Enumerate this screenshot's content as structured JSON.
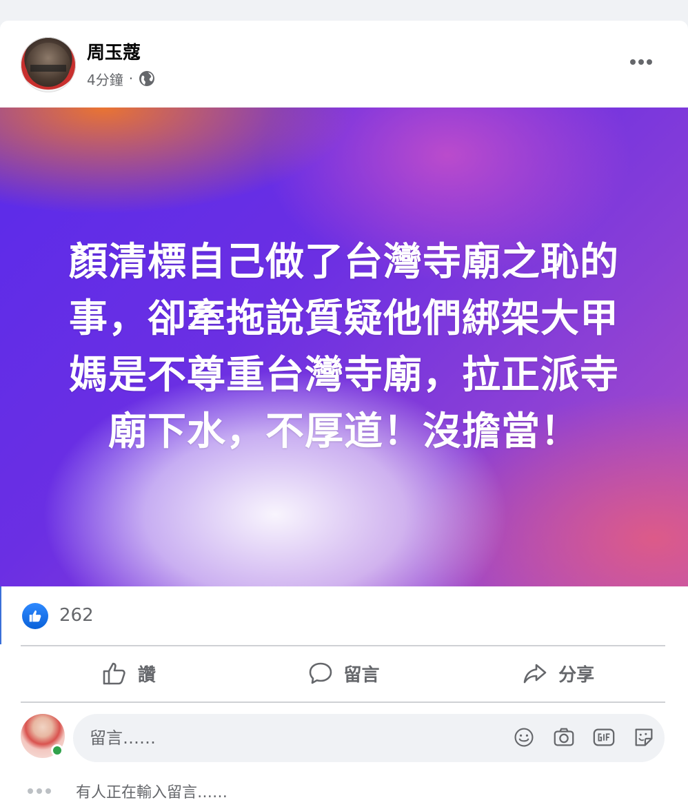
{
  "post": {
    "author": "周玉蔻",
    "time": "4分鐘",
    "separator": "·",
    "privacy_icon": "globe-icon",
    "menu_icon": "more-options-icon",
    "text_lines": [
      "顏清標自己做了台灣寺廟之恥的",
      "事，卻牽拖說質疑他們綁架大甲",
      "媽是不尊重台灣寺廟，拉正派寺",
      "廟下水，不厚道！沒擔當！"
    ]
  },
  "reactions": {
    "icon": "like-icon",
    "count": "262"
  },
  "actions": [
    {
      "label": "讚",
      "icon": "thumbs-up-icon"
    },
    {
      "label": "留言",
      "icon": "comment-bubble-icon"
    },
    {
      "label": "分享",
      "icon": "share-arrow-icon"
    }
  ],
  "comment_box": {
    "placeholder": "留言……",
    "icons": [
      "emoji-icon",
      "camera-icon",
      "gif-icon",
      "sticker-icon"
    ]
  },
  "typing_indicator": "有人正在輸入留言……",
  "colors": {
    "accent": "#1877f2",
    "online": "#31a24c",
    "secondary_text": "#65676b"
  }
}
